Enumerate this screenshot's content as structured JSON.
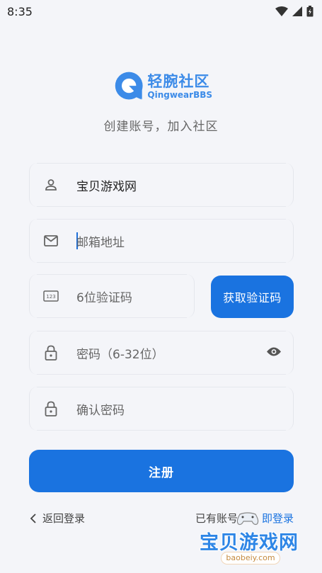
{
  "status_bar": {
    "time": "8:35"
  },
  "logo": {
    "name_cn": "轻腕社区",
    "name_en": "QingwearBBS"
  },
  "subtitle": "创建账号，加入社区",
  "form": {
    "username": {
      "value": "宝贝游戏网"
    },
    "email": {
      "placeholder": "邮箱地址"
    },
    "code": {
      "placeholder": "6位验证码"
    },
    "get_code_button": "获取验证码",
    "password": {
      "placeholder": "密码（6-32位）"
    },
    "confirm_password": {
      "placeholder": "确认密码"
    }
  },
  "register_button": "注册",
  "footer": {
    "back_to_login": "返回登录",
    "have_account": "已有账号",
    "login_now": "即登录"
  },
  "watermark": {
    "name_cn": "宝贝游戏网",
    "domain": "baobeiy.com"
  },
  "colors": {
    "accent": "#1a73e0",
    "background": "#f4f5f9",
    "logo": "#3c8be8"
  }
}
